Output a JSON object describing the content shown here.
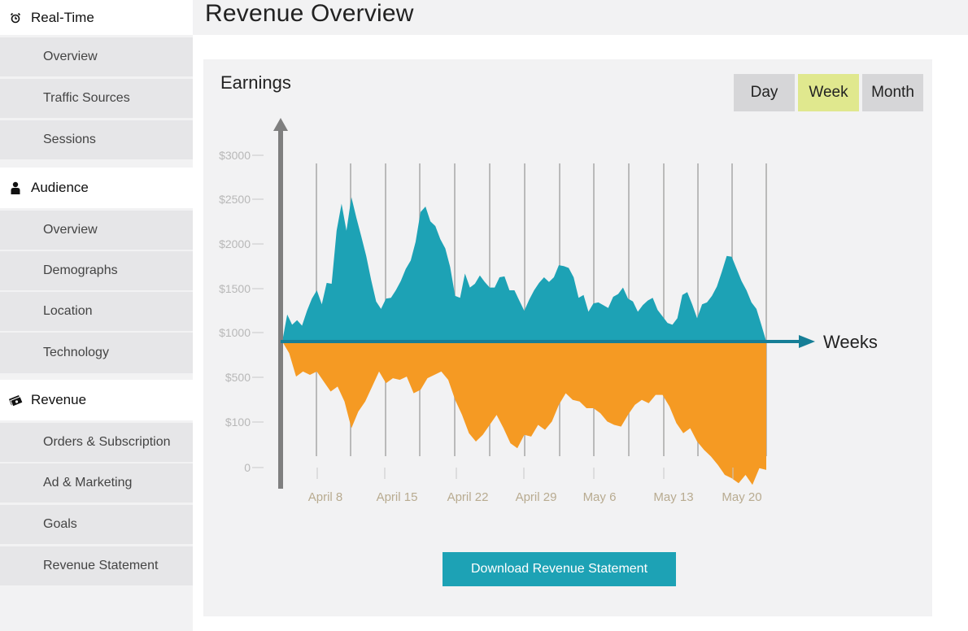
{
  "sidebar": {
    "sections": [
      {
        "label": "Real-Time",
        "icon": "alarm-clock-icon",
        "items": [
          "Overview",
          "Traffic Sources",
          "Sessions"
        ]
      },
      {
        "label": "Audience",
        "icon": "person-icon",
        "items": [
          "Overview",
          "Demographs",
          "Location",
          "Technology"
        ]
      },
      {
        "label": "Revenue",
        "icon": "money-icon",
        "items": [
          "Orders & Subscription",
          "Ad & Marketing",
          "Goals",
          "Revenue Statement"
        ]
      }
    ]
  },
  "header": {
    "title": "Revenue Overview"
  },
  "panel": {
    "title": "Earnings",
    "toggles": {
      "day": "Day",
      "week": "Week",
      "month": "Month",
      "selected": "Week"
    },
    "download_label": "Download Revenue Statement"
  },
  "colors": {
    "accent": "#1da2b5",
    "positive_area": "#1da2b5",
    "negative_area": "#f59a23",
    "selected_toggle": "#e0e88e"
  },
  "chart_data": {
    "type": "area",
    "title": "Earnings",
    "xlabel": "Weeks",
    "ylabel": "",
    "y_ticks": [
      "$3000",
      "$2500",
      "$2000",
      "$1500",
      "$1000",
      "$500",
      "$100",
      "0"
    ],
    "x_ticks": [
      "April 8",
      "April 15",
      "April 22",
      "April 29",
      "May 6",
      "May 13",
      "May 20"
    ],
    "baseline": 1000,
    "series": [
      {
        "values": [
          1000,
          1290,
          1180,
          1230,
          1170,
          1330,
          1460,
          1550,
          1400,
          1630,
          1620,
          2190,
          2480,
          2190,
          2550,
          2330,
          2130,
          1920,
          1660,
          1430,
          1350,
          1460,
          1470,
          1550,
          1650,
          1780,
          1870,
          2070,
          2390,
          2450,
          2290,
          2240,
          2100,
          2000,
          1800,
          1490,
          1470,
          1730,
          1580,
          1620,
          1710,
          1640,
          1580,
          1580,
          1690,
          1700,
          1550,
          1550,
          1440,
          1330,
          1450,
          1550,
          1630,
          1690,
          1640,
          1690,
          1820,
          1810,
          1790,
          1690,
          1470,
          1500,
          1320,
          1410,
          1420,
          1390,
          1360,
          1480,
          1510,
          1580,
          1460,
          1430,
          1320,
          1390,
          1440,
          1470,
          1340,
          1270,
          1200,
          1180,
          1250,
          1500,
          1530,
          1400,
          1250,
          1400,
          1420,
          1490,
          1590,
          1750,
          1920,
          1910,
          1780,
          1650,
          1550,
          1420,
          1350,
          1180,
          1000
        ]
      },
      {
        "values": [
          1000,
          930,
          790,
          820,
          800,
          820,
          760,
          700,
          730,
          640,
          480,
          580,
          640,
          730,
          820,
          750,
          780,
          770,
          790,
          690,
          710,
          780,
          800,
          820,
          770,
          650,
          560,
          450,
          400,
          440,
          500,
          560,
          480,
          390,
          360,
          440,
          430,
          500,
          470,
          520,
          620,
          690,
          650,
          640,
          600,
          600,
          570,
          520,
          500,
          490,
          560,
          620,
          650,
          630,
          680,
          680,
          610,
          510,
          450,
          480,
          400,
          350,
          310,
          260,
          200,
          180,
          150,
          200,
          140,
          240,
          230
        ]
      }
    ]
  }
}
